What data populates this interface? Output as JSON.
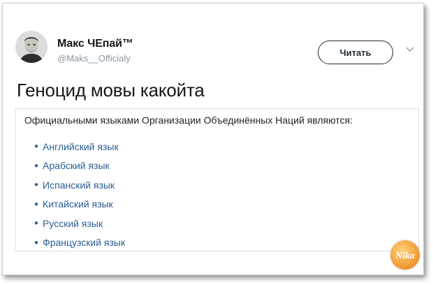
{
  "tweet": {
    "author_name": "Макс ЧЕпай™",
    "author_handle": "@Maks__Officialy",
    "follow_label": "Читать",
    "text": "Геноцид мовы какойта"
  },
  "quote": {
    "intro": "Официальными языками Организации Объединённых Наций являются:",
    "items": [
      "Английский язык",
      "Арабский язык",
      "Испанский язык",
      "Китайский язык",
      "Русский язык",
      "Французский язык"
    ]
  },
  "watermark": {
    "logo_text": "Nika"
  },
  "icons": {
    "avatar": "man-portrait",
    "menu": "chevron-down-icon"
  },
  "colors": {
    "link": "#2b5d93",
    "text": "#14171a",
    "handle": "#8b9aa5"
  }
}
